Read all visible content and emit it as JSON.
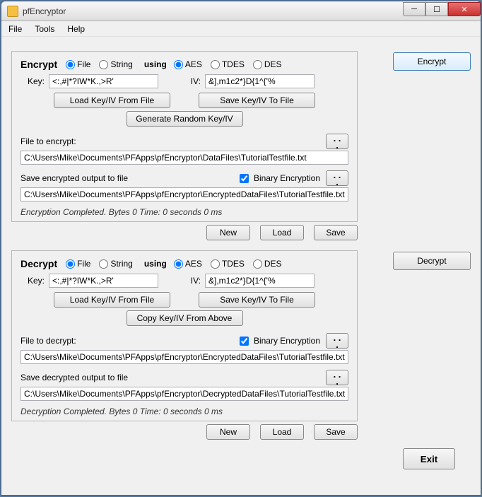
{
  "window": {
    "title": "pfEncryptor"
  },
  "menu": {
    "file": "File",
    "tools": "Tools",
    "help": "Help"
  },
  "encrypt": {
    "title": "Encrypt",
    "mode_file": "File",
    "mode_string": "String",
    "using": "using",
    "algo_aes": "AES",
    "algo_tdes": "TDES",
    "algo_des": "DES",
    "key_label": "Key:",
    "key_value": "<:,#|*?IW*K.,>R'",
    "iv_label": "IV:",
    "iv_value": "&],m1c2*}D{1^{'%",
    "load_kv": "Load Key/IV From File",
    "save_kv": "Save Key/IV To File",
    "gen_kv": "Generate Random Key/IV",
    "file_to_encrypt_label": "File to encrypt:",
    "file_to_encrypt": "C:\\Users\\Mike\\Documents\\PFApps\\pfEncryptor\\DataFiles\\TutorialTestfile.txt",
    "save_output_label": "Save encrypted output to file",
    "binary_label": "Binary Encryption",
    "save_output": "C:\\Users\\Mike\\Documents\\PFApps\\pfEncryptor\\EncryptedDataFiles\\TutorialTestfile.txt.en",
    "status": "Encryption Completed. Bytes  0  Time: 0 seconds 0 ms",
    "btn_new": "New",
    "btn_load": "Load",
    "btn_save": "Save",
    "btn_main": "Encrypt"
  },
  "decrypt": {
    "title": "Decrypt",
    "mode_file": "File",
    "mode_string": "String",
    "using": "using",
    "algo_aes": "AES",
    "algo_tdes": "TDES",
    "algo_des": "DES",
    "key_label": "Key:",
    "key_value": "<:,#|*?IW*K.,>R'",
    "iv_label": "IV:",
    "iv_value": "&],m1c2*}D{1^{'%",
    "load_kv": "Load Key/IV From File",
    "save_kv": "Save Key/IV To File",
    "copy_kv": "Copy Key/IV From Above",
    "file_to_decrypt_label": "File to decrypt:",
    "binary_label": "Binary Encryption",
    "file_to_decrypt": "C:\\Users\\Mike\\Documents\\PFApps\\pfEncryptor\\EncryptedDataFiles\\TutorialTestfile.txt.en",
    "save_output_label": "Save decrypted output to file",
    "save_output": "C:\\Users\\Mike\\Documents\\PFApps\\pfEncryptor\\DecryptedDataFiles\\TutorialTestfile.txt.d",
    "status": "Decryption Completed. Bytes  0  Time: 0 seconds 0 ms",
    "btn_new": "New",
    "btn_load": "Load",
    "btn_save": "Save",
    "btn_main": "Decrypt"
  },
  "exit": "Exit"
}
